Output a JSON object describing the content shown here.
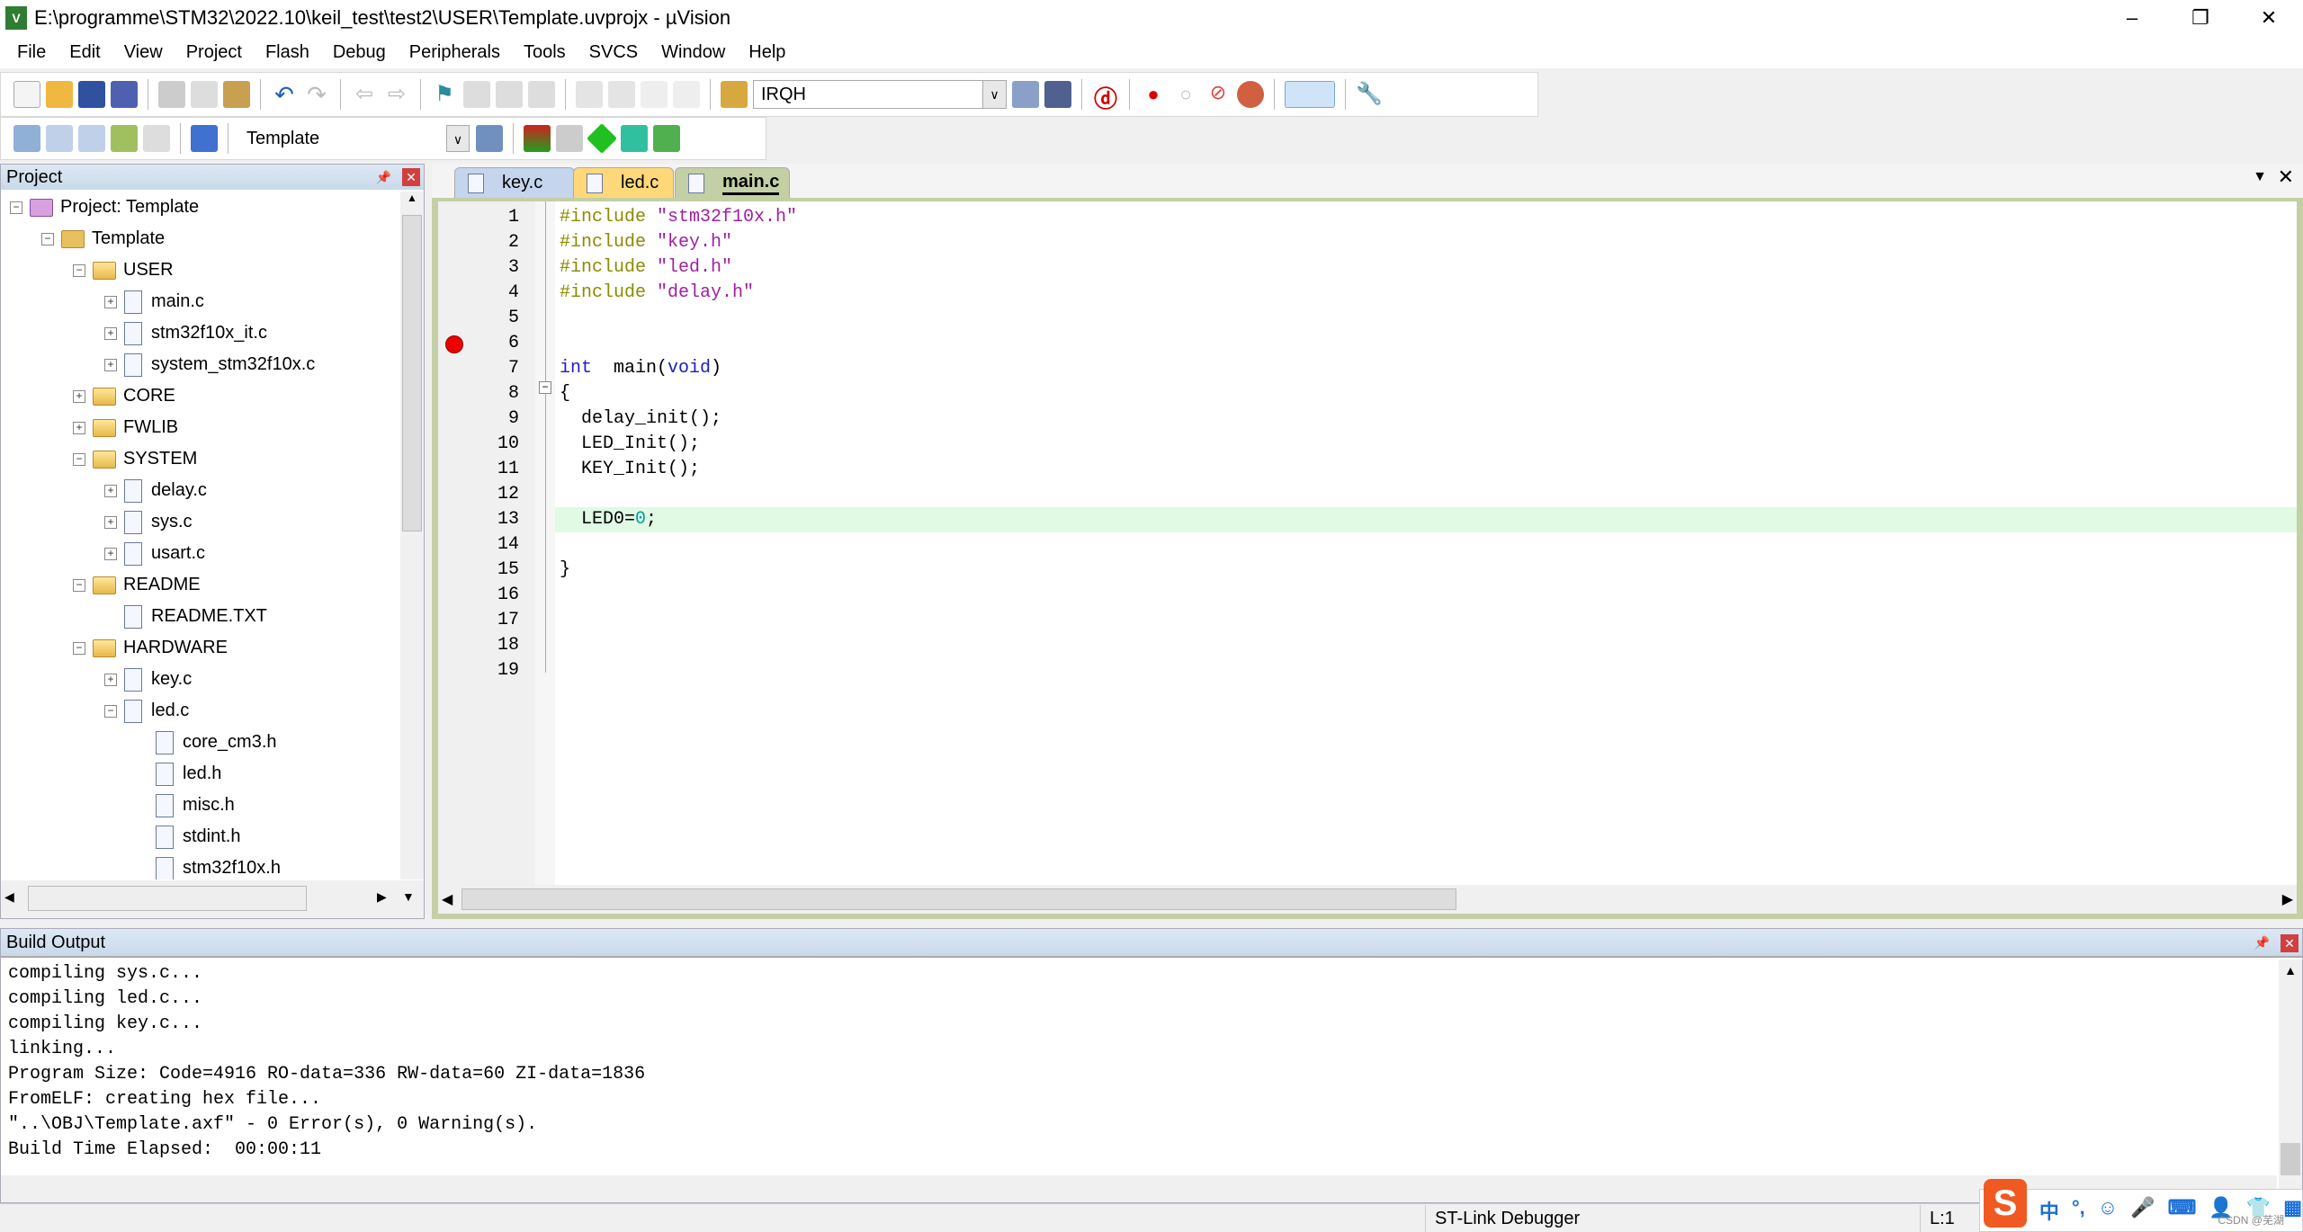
{
  "window": {
    "title": "E:\\programme\\STM32\\2022.10\\keil_test\\test2\\USER\\Template.uvprojx - µVision",
    "logo": "V",
    "controls": [
      "–",
      "❐",
      "✕"
    ]
  },
  "menu": [
    "File",
    "Edit",
    "View",
    "Project",
    "Flash",
    "Debug",
    "Peripherals",
    "Tools",
    "SVCS",
    "Window",
    "Help"
  ],
  "toolbar": {
    "find_combo": "IRQH",
    "target_combo": "Template"
  },
  "project_panel": {
    "title": "Project",
    "pin": "📌",
    "close": "✕",
    "tree": [
      {
        "label": "Project: Template",
        "level": 0,
        "kind": "project",
        "exp": "-"
      },
      {
        "label": "Template",
        "level": 1,
        "kind": "target",
        "exp": "-"
      },
      {
        "label": "USER",
        "level": 2,
        "kind": "folder",
        "exp": "-"
      },
      {
        "label": "main.c",
        "level": 3,
        "kind": "file",
        "exp": "+"
      },
      {
        "label": "stm32f10x_it.c",
        "level": 3,
        "kind": "file",
        "exp": "+"
      },
      {
        "label": "system_stm32f10x.c",
        "level": 3,
        "kind": "file",
        "exp": "+"
      },
      {
        "label": "CORE",
        "level": 2,
        "kind": "folder",
        "exp": "+"
      },
      {
        "label": "FWLIB",
        "level": 2,
        "kind": "folder",
        "exp": "+"
      },
      {
        "label": "SYSTEM",
        "level": 2,
        "kind": "folder",
        "exp": "-"
      },
      {
        "label": "delay.c",
        "level": 3,
        "kind": "file",
        "exp": "+"
      },
      {
        "label": "sys.c",
        "level": 3,
        "kind": "file",
        "exp": "+"
      },
      {
        "label": "usart.c",
        "level": 3,
        "kind": "file",
        "exp": "+"
      },
      {
        "label": "README",
        "level": 2,
        "kind": "folder",
        "exp": "-"
      },
      {
        "label": "README.TXT",
        "level": 3,
        "kind": "file",
        "exp": ""
      },
      {
        "label": "HARDWARE",
        "level": 2,
        "kind": "folder",
        "exp": "-"
      },
      {
        "label": "key.c",
        "level": 3,
        "kind": "file",
        "exp": "+"
      },
      {
        "label": "led.c",
        "level": 3,
        "kind": "file",
        "exp": "-"
      },
      {
        "label": "core_cm3.h",
        "level": 4,
        "kind": "file",
        "exp": ""
      },
      {
        "label": "led.h",
        "level": 4,
        "kind": "file",
        "exp": ""
      },
      {
        "label": "misc.h",
        "level": 4,
        "kind": "file",
        "exp": ""
      },
      {
        "label": "stdint.h",
        "level": 4,
        "kind": "file",
        "exp": ""
      },
      {
        "label": "stm32f10x.h",
        "level": 4,
        "kind": "file",
        "exp": ""
      }
    ]
  },
  "editor": {
    "tabs": [
      {
        "label": "key.c",
        "color": "#c5d5ee"
      },
      {
        "label": "led.c",
        "color": "#ffd87a"
      },
      {
        "label": "main.c",
        "color": "#c3cfa5",
        "active": true
      }
    ],
    "breakpoint_line": 6,
    "highlight_line": 13,
    "lines": [
      [
        [
          "pp",
          "#include "
        ],
        [
          "str",
          "\"stm32f10x.h\""
        ]
      ],
      [
        [
          "pp",
          "#include "
        ],
        [
          "str",
          "\"key.h\""
        ]
      ],
      [
        [
          "pp",
          "#include "
        ],
        [
          "str",
          "\"led.h\""
        ]
      ],
      [
        [
          "pp",
          "#include "
        ],
        [
          "str",
          "\"delay.h\""
        ]
      ],
      [],
      [],
      [
        [
          "kw",
          "int"
        ],
        [
          "",
          "  main("
        ],
        [
          "kw",
          "void"
        ],
        [
          "",
          ")"
        ]
      ],
      [
        [
          "",
          "{"
        ]
      ],
      [
        [
          "",
          "  delay_init();"
        ]
      ],
      [
        [
          "",
          "  LED_Init();"
        ]
      ],
      [
        [
          "",
          "  KEY_Init();"
        ]
      ],
      [],
      [
        [
          "",
          "  LED0="
        ],
        [
          "num",
          "0"
        ],
        [
          "",
          ";"
        ]
      ],
      [],
      [
        [
          "",
          "}"
        ]
      ],
      [],
      [],
      [],
      []
    ]
  },
  "build_output": {
    "title": "Build Output",
    "lines": [
      "compiling sys.c...",
      "compiling led.c...",
      "compiling key.c...",
      "linking...",
      "Program Size: Code=4916 RO-data=336 RW-data=60 ZI-data=1836",
      "FromELF: creating hex file...",
      "\"..\\OBJ\\Template.axf\" - 0 Error(s), 0 Warning(s).",
      "Build Time Elapsed:  00:00:11"
    ]
  },
  "status": {
    "debugger": "ST-Link Debugger",
    "position": "L:1"
  },
  "ime": {
    "logo": "S",
    "items": [
      "中",
      "°,",
      "☺",
      "🎤",
      "⌨",
      "👤",
      "👕",
      "▦"
    ],
    "watermark": "CSDN @芜湖"
  }
}
